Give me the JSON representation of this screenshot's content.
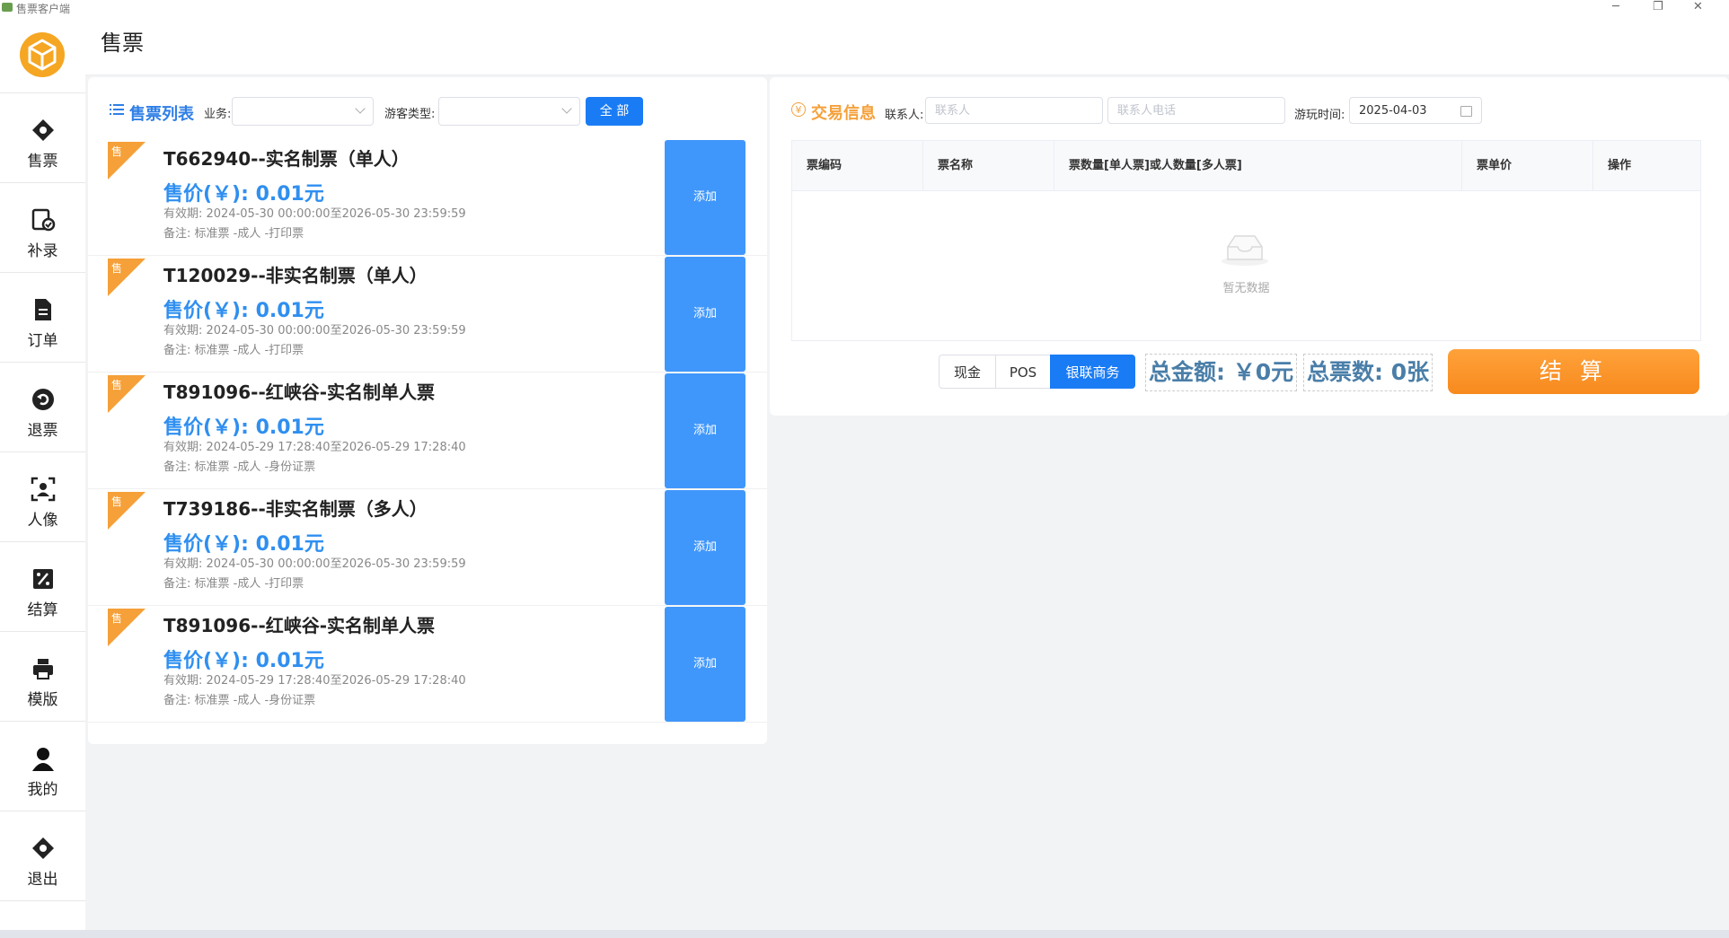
{
  "window": {
    "title": "售票客户端",
    "controls": {
      "minimize": "─",
      "restore": "❐",
      "close": "✕"
    }
  },
  "sidebar": {
    "logo": "cube-logo-icon",
    "items": [
      {
        "label": "售票",
        "icon": "ticket-icon"
      },
      {
        "label": "补录",
        "icon": "supplement-icon"
      },
      {
        "label": "订单",
        "icon": "document-icon"
      },
      {
        "label": "退票",
        "icon": "refund-icon"
      },
      {
        "label": "人像",
        "icon": "portrait-icon"
      },
      {
        "label": "结算",
        "icon": "percent-icon"
      },
      {
        "label": "模版",
        "icon": "printer-icon"
      },
      {
        "label": "我的",
        "icon": "user-icon"
      },
      {
        "label": "退出",
        "icon": "exit-icon"
      }
    ]
  },
  "header": {
    "title": "售票"
  },
  "ticket_list": {
    "title": "售票列表",
    "filters": {
      "business_label": "业务:",
      "visitor_type_label": "游客类型:",
      "all_button": "全 部"
    },
    "tag": "售",
    "add_label": "添加",
    "items": [
      {
        "name": "T662940--实名制票（单人）",
        "price": "售价(￥):  0.01元",
        "valid": "有效期:  2024-05-30 00:00:00至2026-05-30 23:59:59",
        "note": "备注:  标准票 -成人 -打印票"
      },
      {
        "name": "T120029--非实名制票（单人）",
        "price": "售价(￥):  0.01元",
        "valid": "有效期:  2024-05-30 00:00:00至2026-05-30 23:59:59",
        "note": "备注:  标准票 -成人 -打印票"
      },
      {
        "name": "T891096--红峡谷-实名制单人票",
        "price": "售价(￥):  0.01元",
        "valid": "有效期:  2024-05-29 17:28:40至2026-05-29 17:28:40",
        "note": "备注:  标准票 -成人 -身份证票"
      },
      {
        "name": "T739186--非实名制票（多人）",
        "price": "售价(￥):  0.01元",
        "valid": "有效期:  2024-05-30 00:00:00至2026-05-30 23:59:59",
        "note": "备注:  标准票 -成人 -打印票"
      },
      {
        "name": "T891096--红峡谷-实名制单人票",
        "price": "售价(￥):  0.01元",
        "valid": "有效期:  2024-05-29 17:28:40至2026-05-29 17:28:40",
        "note": "备注:  标准票 -成人 -身份证票"
      }
    ]
  },
  "trade": {
    "title": "交易信息",
    "contact_label": "联系人:",
    "contact_placeholder": "联系人",
    "phone_placeholder": "联系人电话",
    "date_label": "游玩时间:",
    "date_value": "2025-04-03",
    "table": {
      "headers": [
        "票编码",
        "票名称",
        "票数量[单人票]或人数量[多人票]",
        "票单价",
        "操作"
      ],
      "empty_text": "暂无数据"
    },
    "payment_methods": [
      "现金",
      "POS",
      "银联商务"
    ],
    "active_payment": "银联商务",
    "total_amount": "总金额: ￥0元",
    "total_tickets": "总票数: 0张",
    "settle_button": "结 算"
  },
  "colors": {
    "primary": "#1a7cf5",
    "add_button": "#4097fb",
    "accent_orange": "#f5a039",
    "price_blue": "#2f8ff0"
  }
}
